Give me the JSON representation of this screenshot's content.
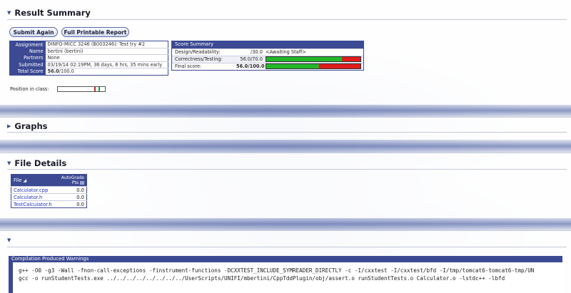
{
  "result_summary": {
    "title": "Result Summary",
    "buttons": {
      "submit_again": "Submit Again",
      "printable_report": "Full Printable Report"
    },
    "info": [
      {
        "key": "Assignment",
        "value": "DINFO-MICC 3246 (B003246): Test try #2"
      },
      {
        "key": "Name",
        "value": "bertini (bertini)"
      },
      {
        "key": "Partners",
        "value": "None"
      },
      {
        "key": "Submitted",
        "value": "03/19/14 02:19PM, 36 days, 8 hrs, 35 mins early"
      },
      {
        "key": "Total Score",
        "value_bold": "56.0",
        "value_rest": "/100.0"
      }
    ],
    "score_summary": {
      "title": "Score Summary",
      "rows": [
        {
          "label": "Design/Readability:",
          "value": "/30.0",
          "status": "<Awaiting Staff>"
        },
        {
          "label": "Correctness/Testing:",
          "value": "56.0/70.0",
          "fraction": 0.8
        },
        {
          "label": "Final score:",
          "value": "56.0/100.0",
          "fraction": 0.56
        }
      ]
    },
    "position_label": "Position in class:",
    "position_markers": [
      {
        "fraction": 0.78,
        "color": "#cc2222"
      },
      {
        "fraction": 0.86,
        "color": "#229933"
      }
    ]
  },
  "graphs": {
    "title": "Graphs"
  },
  "file_details": {
    "title": "File Details",
    "columns": {
      "file": "File",
      "autograde_line1": "AutoGrade",
      "autograde_line2": "Pts"
    },
    "files": [
      {
        "name": "Calculator.cpp",
        "pts": "0.0"
      },
      {
        "name": "Calculator.h",
        "pts": "0.0"
      },
      {
        "name": "TestCalculator.h",
        "pts": "0.0"
      }
    ]
  },
  "compilation": {
    "title": "Compilation Produced Warnings",
    "lines": [
      "g++ -O0 -g3 -Wall -fnon-call-exceptions -finstrument-functions -DCXXTEST_INCLUDE_SYMREADER_DIRECTLY -c -I/cxxtest -I/cxxtest/bfd -I/tmp/tomcat6-tomcat6-tmp/UN",
      "gcc -o runStudentTests.exe ../../../../../../../../UserScripts/UNIFI/mbertini/CppTddPlugin/obj/assert.o runStudentTests.o Calculator.o -lstdc++ -lbfd"
    ]
  },
  "colors": {
    "accent": "#3c4a93",
    "bar_green": "#22b829",
    "bar_red": "#e21b1b",
    "link": "#2333b5"
  }
}
